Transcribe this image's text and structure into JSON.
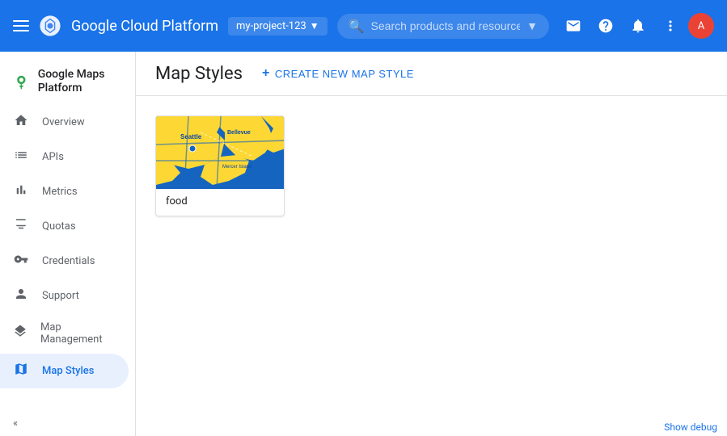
{
  "topNav": {
    "appTitle": "Google Cloud Platform",
    "projectName": "my-project-123",
    "searchPlaceholder": "Search products and resources",
    "icons": {
      "email": "✉",
      "help": "?",
      "bell": "🔔",
      "more": "⋮"
    },
    "avatarInitial": "A"
  },
  "sidebar": {
    "headerTitle": "Google Maps Platform",
    "items": [
      {
        "id": "overview",
        "label": "Overview",
        "icon": "home"
      },
      {
        "id": "apis",
        "label": "APIs",
        "icon": "list"
      },
      {
        "id": "metrics",
        "label": "Metrics",
        "icon": "bar_chart"
      },
      {
        "id": "quotas",
        "label": "Quotas",
        "icon": "monitor"
      },
      {
        "id": "credentials",
        "label": "Credentials",
        "icon": "vpn_key"
      },
      {
        "id": "support",
        "label": "Support",
        "icon": "person"
      },
      {
        "id": "map-management",
        "label": "Map Management",
        "icon": "layers"
      },
      {
        "id": "map-styles",
        "label": "Map Styles",
        "icon": "map",
        "active": true
      }
    ],
    "collapseLabel": "«"
  },
  "content": {
    "pageTitle": "Map Styles",
    "createButtonLabel": "CREATE NEW MAP STYLE",
    "mapStyleCard": {
      "name": "food"
    }
  },
  "bottomBar": {
    "label": "Show debug"
  }
}
